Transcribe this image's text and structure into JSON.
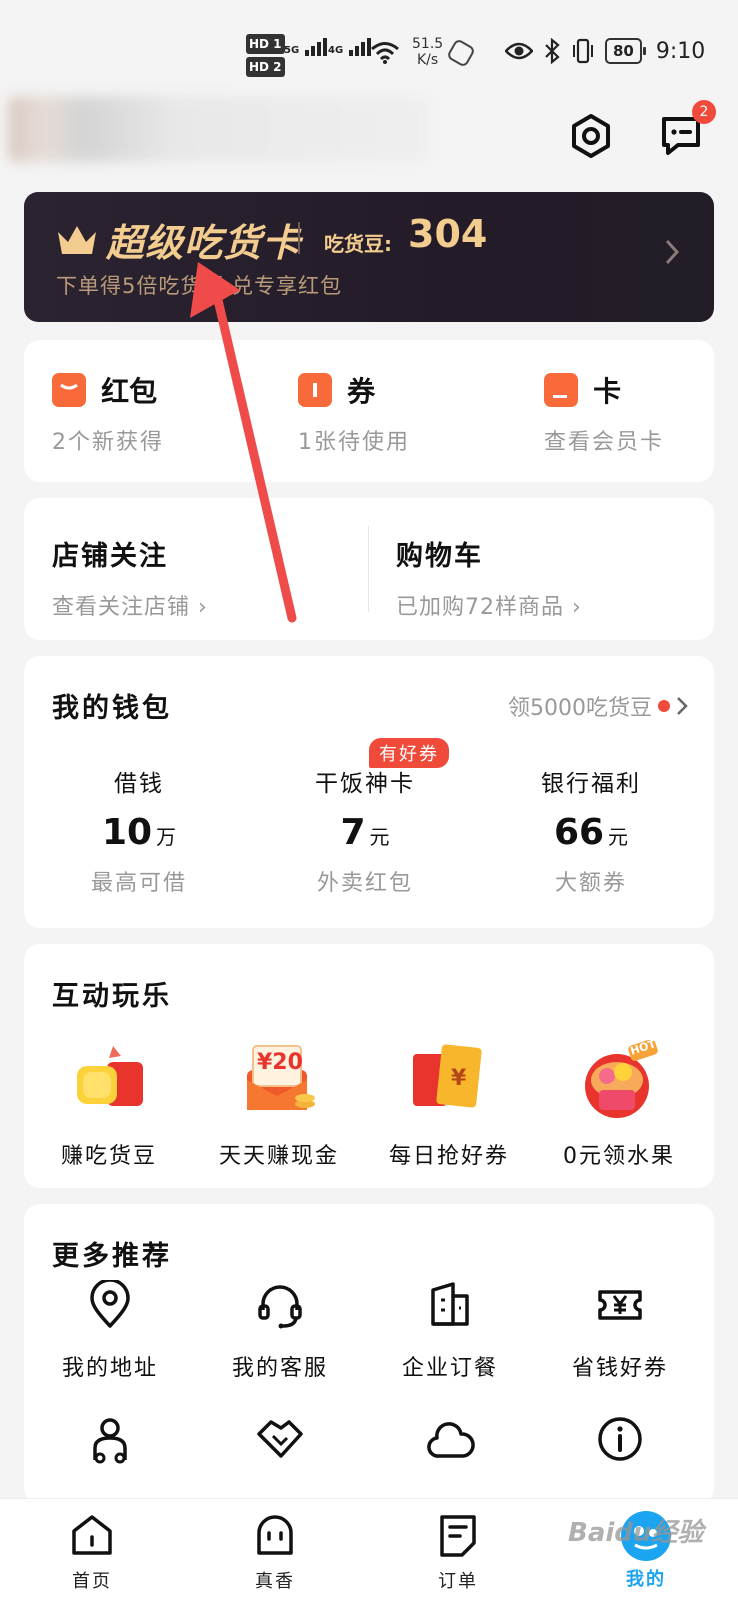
{
  "status_bar": {
    "sim1": "HD 1",
    "sim2": "HD 2",
    "net1": "5G",
    "net2": "4G",
    "speed_value": "51.5",
    "speed_unit": "K/s",
    "battery": "80",
    "time": "9:10"
  },
  "header": {
    "messages_badge": "2",
    "icons": [
      "settings-icon",
      "messages-icon"
    ]
  },
  "vip_card": {
    "title": "超级吃货卡",
    "beans_label": "吃货豆:",
    "beans_value": "304",
    "subtitle": "下单得5倍吃货豆,兑专享红包"
  },
  "assets": [
    {
      "title": "红包",
      "subtitle": "2个新获得"
    },
    {
      "title": "券",
      "subtitle": "1张待使用"
    },
    {
      "title": "卡",
      "subtitle": "查看会员卡"
    }
  ],
  "follow": [
    {
      "title": "店铺关注",
      "subtitle": "查看关注店铺 ›"
    },
    {
      "title": "购物车",
      "subtitle": "已加购72样商品 ›"
    }
  ],
  "wallet": {
    "title": "我的钱包",
    "promo": "领5000吃货豆",
    "tag": "有好券",
    "items": [
      {
        "label": "借钱",
        "value": "10",
        "unit": "万",
        "subtitle": "最高可借"
      },
      {
        "label": "干饭神卡",
        "value": "7",
        "unit": "元",
        "subtitle": "外卖红包"
      },
      {
        "label": "银行福利",
        "value": "66",
        "unit": "元",
        "subtitle": "大额券"
      }
    ]
  },
  "fun": {
    "title": "互动玩乐",
    "items": [
      {
        "label": "赚吃货豆"
      },
      {
        "label": "天天赚现金",
        "badge": "¥20"
      },
      {
        "label": "每日抢好券",
        "badge": "¥"
      },
      {
        "label": "0元领水果",
        "badge": "HOT"
      }
    ]
  },
  "more": {
    "title": "更多推荐",
    "items": [
      {
        "label": "我的地址",
        "icon": "location-icon"
      },
      {
        "label": "我的客服",
        "icon": "headset-icon"
      },
      {
        "label": "企业订餐",
        "icon": "building-icon"
      },
      {
        "label": "省钱好券",
        "icon": "yen-ticket-icon"
      }
    ],
    "items_row2_icons": [
      "scooter-icon",
      "handshake-icon",
      "cloud-icon",
      "info-icon"
    ]
  },
  "tabs": [
    {
      "label": "首页"
    },
    {
      "label": "真香"
    },
    {
      "label": "订单"
    },
    {
      "label": "我的"
    }
  ],
  "watermark": "Baidu经验",
  "colors": {
    "accent": "#f86a3a",
    "badge_red": "#f04a3a",
    "active_tab": "#1ba4f0",
    "vip_gold": "#f3cc8f",
    "vip_bg": "#231c28",
    "annotation_arrow": "#f04b4b"
  }
}
